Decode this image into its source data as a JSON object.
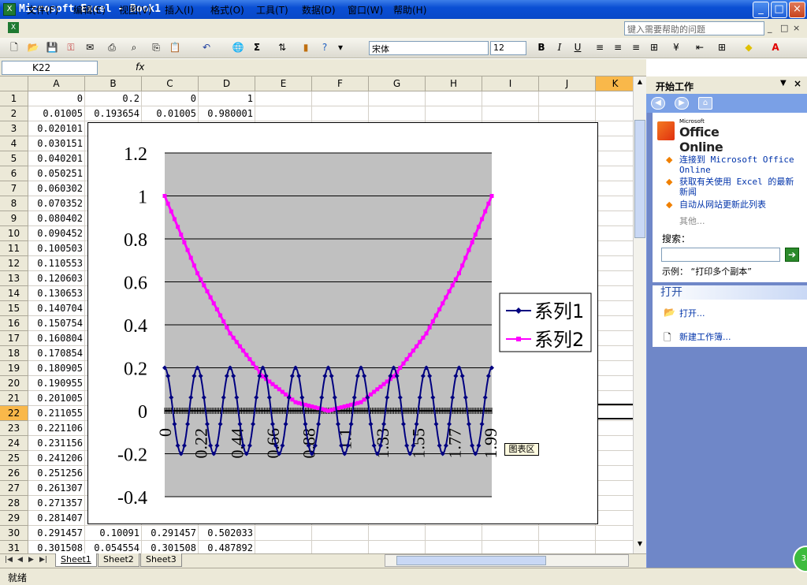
{
  "window": {
    "title": "Microsoft Excel - Book1",
    "icon": "excel-icon",
    "minimize": "_",
    "restore": "□",
    "close": "×"
  },
  "menu": {
    "items": [
      "文件(F)",
      "编辑(E)",
      "视图(V)",
      "插入(I)",
      "格式(O)",
      "工具(T)",
      "数据(D)",
      "窗口(W)",
      "帮助(H)"
    ],
    "help_placeholder": "键入需要帮助的问题",
    "mdi_minimize": "_",
    "mdi_restore": "□",
    "mdi_close": "×"
  },
  "toolbar": {
    "font_name": "宋体",
    "font_size": "12",
    "bold": "B",
    "italic": "I",
    "underline": "U",
    "sum": "Σ",
    "zoom_dropdown": "▾"
  },
  "formula": {
    "name_box": "K22",
    "fx": "fx"
  },
  "columns": [
    "A",
    "B",
    "C",
    "D",
    "E",
    "F",
    "G",
    "H",
    "I",
    "J",
    "K"
  ],
  "selected_column": "K",
  "selected_row": "22",
  "rows": [
    {
      "n": "1",
      "a": "0",
      "b": "0.2",
      "c": "0",
      "d": "1"
    },
    {
      "n": "2",
      "a": "0.01005",
      "b": "0.193654",
      "c": "0.01005",
      "d": "0.980001"
    },
    {
      "n": "3",
      "a": "0.020101"
    },
    {
      "n": "4",
      "a": "0.030151"
    },
    {
      "n": "5",
      "a": "0.040201"
    },
    {
      "n": "6",
      "a": "0.050251"
    },
    {
      "n": "7",
      "a": "0.060302"
    },
    {
      "n": "8",
      "a": "0.070352"
    },
    {
      "n": "9",
      "a": "0.080402"
    },
    {
      "n": "10",
      "a": "0.090452"
    },
    {
      "n": "11",
      "a": "0.100503"
    },
    {
      "n": "12",
      "a": "0.110553"
    },
    {
      "n": "13",
      "a": "0.120603"
    },
    {
      "n": "14",
      "a": "0.130653"
    },
    {
      "n": "15",
      "a": "0.140704"
    },
    {
      "n": "16",
      "a": "0.150754"
    },
    {
      "n": "17",
      "a": "0.160804"
    },
    {
      "n": "18",
      "a": "0.170854"
    },
    {
      "n": "19",
      "a": "0.180905"
    },
    {
      "n": "20",
      "a": "0.190955"
    },
    {
      "n": "21",
      "a": "0.201005"
    },
    {
      "n": "22",
      "a": "0.211055"
    },
    {
      "n": "23",
      "a": "0.221106"
    },
    {
      "n": "24",
      "a": "0.231156"
    },
    {
      "n": "25",
      "a": "0.241206"
    },
    {
      "n": "26",
      "a": "0.251256"
    },
    {
      "n": "27",
      "a": "0.261307"
    },
    {
      "n": "28",
      "a": "0.271357"
    },
    {
      "n": "29",
      "a": "0.281407"
    },
    {
      "n": "30",
      "a": "0.291457",
      "b": "0.10091",
      "c": "0.291457",
      "d": "0.502033"
    },
    {
      "n": "31",
      "a": "0.301508",
      "b": "0.054554",
      "c": "0.301508",
      "d": "0.487892"
    }
  ],
  "chart_data": {
    "type": "line",
    "title": "",
    "xlabel": "",
    "ylabel": "",
    "ylim": [
      -0.4,
      1.2
    ],
    "yticks": [
      "1.2",
      "1",
      "0.8",
      "0.6",
      "0.4",
      "0.2",
      "0",
      "-0.2",
      "-0.4"
    ],
    "xtick_labels": [
      "0",
      "0.22",
      "0.44",
      "0.66",
      "0.88",
      "1.1",
      "1.33",
      "1.55",
      "1.77",
      "1.99"
    ],
    "x_range": [
      0,
      2
    ],
    "grid": true,
    "legend_position": "right",
    "series": [
      {
        "name": "系列1",
        "color": "#000080",
        "marker": "diamond",
        "description_points": [
          [
            0,
            0.2
          ],
          [
            0.1,
            -0.2
          ],
          [
            0.2,
            0.2
          ],
          [
            0.3,
            -0.2
          ],
          [
            0.4,
            0.2
          ],
          [
            0.5,
            -0.2
          ],
          [
            0.6,
            0.2
          ],
          [
            0.7,
            -0.2
          ],
          [
            0.8,
            0.2
          ],
          [
            0.9,
            -0.2
          ],
          [
            1.0,
            0.2
          ],
          [
            1.1,
            -0.2
          ],
          [
            1.2,
            0.2
          ],
          [
            1.3,
            -0.2
          ],
          [
            1.4,
            0.2
          ],
          [
            1.5,
            -0.2
          ],
          [
            1.6,
            0.2
          ],
          [
            1.7,
            -0.2
          ],
          [
            1.8,
            0.2
          ],
          [
            1.9,
            -0.2
          ],
          [
            2.0,
            0.2
          ]
        ]
      },
      {
        "name": "系列2",
        "color": "#ff00ff",
        "marker": "square",
        "description_points": [
          [
            0,
            1
          ],
          [
            0.2,
            0.64
          ],
          [
            0.4,
            0.36
          ],
          [
            0.6,
            0.16
          ],
          [
            0.8,
            0.04
          ],
          [
            1.0,
            0
          ],
          [
            1.2,
            0.04
          ],
          [
            1.4,
            0.16
          ],
          [
            1.6,
            0.36
          ],
          [
            1.8,
            0.64
          ],
          [
            2.0,
            1
          ]
        ]
      }
    ],
    "tooltip": "图表区"
  },
  "sheets": [
    "Sheet1",
    "Sheet2",
    "Sheet3"
  ],
  "status": "就绪",
  "taskpane": {
    "title": "开始工作",
    "brand": "Office Online",
    "brand_small": "Microsoft",
    "links": [
      "连接到 Microsoft Office Online",
      "获取有关使用 Excel 的最新新闻",
      "自动从网站更新此列表"
    ],
    "more": "其他...",
    "search_label": "搜索：",
    "example": "示例：  “打印多个副本”",
    "open_heading": "打开",
    "open_items": [
      "打开...",
      "新建工作簿..."
    ]
  },
  "badge": "35"
}
